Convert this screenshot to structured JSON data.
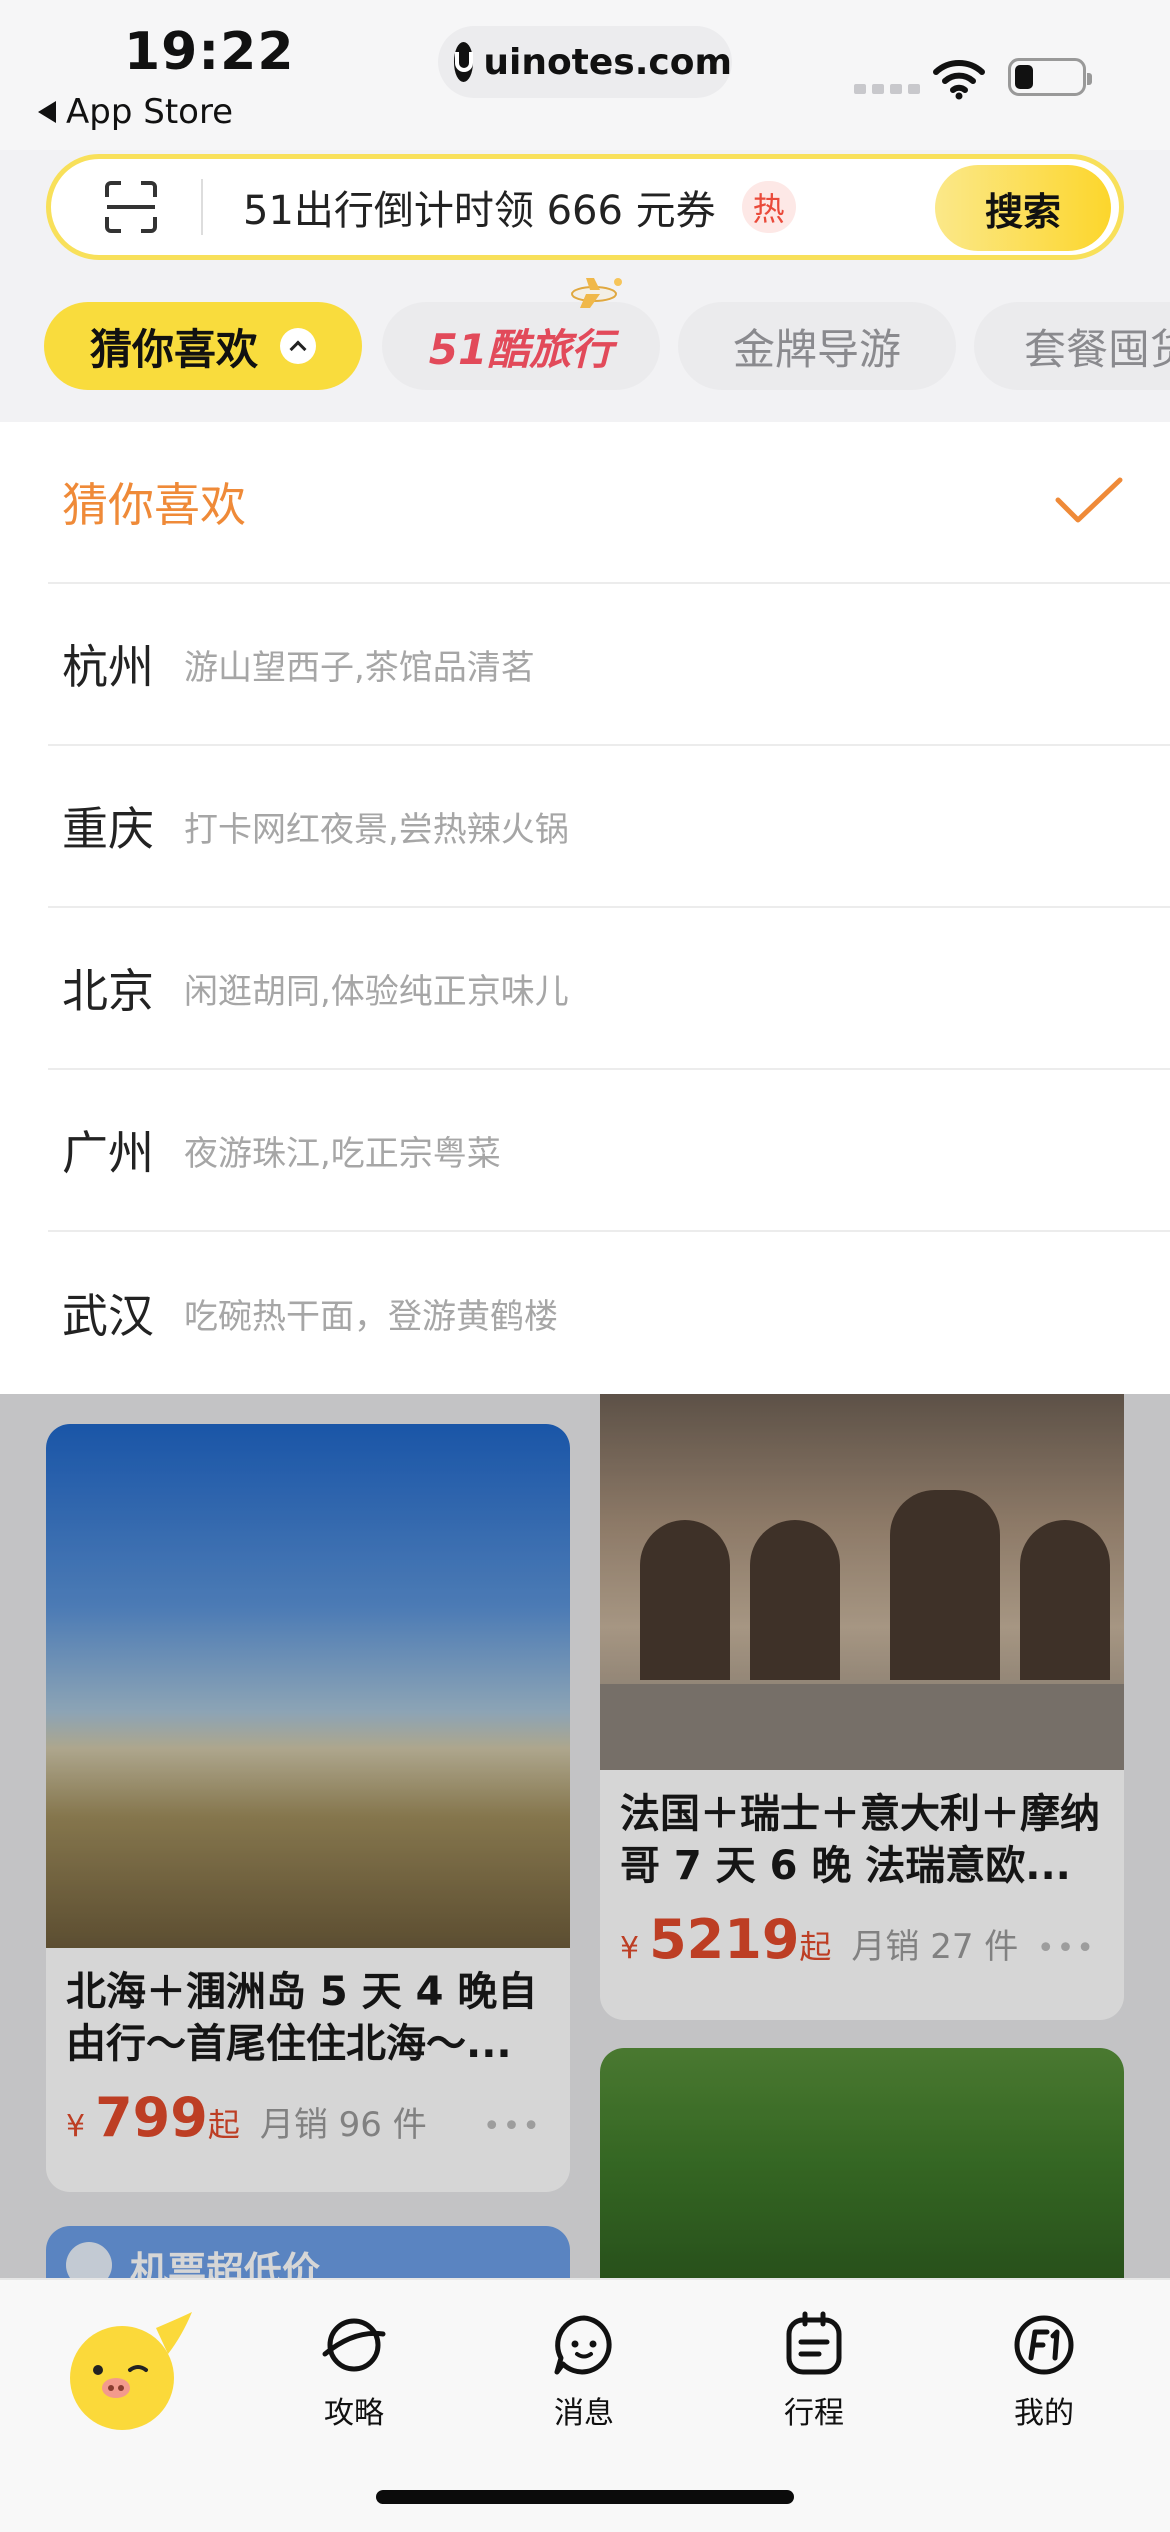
{
  "status_bar": {
    "time": "19:22",
    "back_app": "App Store",
    "url": "uinotes.com"
  },
  "search": {
    "placeholder": "51出行倒计时领 666 元券",
    "hot_badge": "热",
    "button_label": "搜索"
  },
  "tabs": [
    {
      "label": "猜你喜欢",
      "active": true
    },
    {
      "label": "51酷旅行"
    },
    {
      "label": "金牌导游"
    },
    {
      "label": "套餐囤货"
    }
  ],
  "dropdown": {
    "items": [
      {
        "city": "猜你喜欢",
        "desc": "",
        "selected": true
      },
      {
        "city": "杭州",
        "desc": "游山望西子,茶馆品清茗"
      },
      {
        "city": "重庆",
        "desc": "打卡网红夜景,尝热辣火锅"
      },
      {
        "city": "北京",
        "desc": "闲逛胡同,体验纯正京味儿"
      },
      {
        "city": "广州",
        "desc": "夜游珠江,吃正宗粤菜"
      },
      {
        "city": "武汉",
        "desc": "吃碗热干面，登游黄鹤楼"
      }
    ]
  },
  "feed": {
    "cards": [
      {
        "title": "北海＋涠洲岛 5 天 4 晚自由行～首尾住住北海～...",
        "currency": "¥",
        "price": "799",
        "price_suffix": "起",
        "sales": "月销 96 件"
      },
      {
        "title": "法国＋瑞士＋意大利＋摩纳哥 7 天 6 晚 法瑞意欧...",
        "currency": "¥",
        "price": "5219",
        "price_suffix": "起",
        "sales": "月销 27 件"
      }
    ],
    "promo_label": "机票超低价"
  },
  "bottom_nav": {
    "items": [
      {
        "label": "攻略",
        "icon": "planet-icon"
      },
      {
        "label": "消息",
        "icon": "chat-icon"
      },
      {
        "label": "行程",
        "icon": "itinerary-icon"
      },
      {
        "label": "我的",
        "icon": "profile-icon"
      }
    ]
  },
  "colors": {
    "brand_yellow": "#f9dc3d",
    "price_red": "#e24b2c",
    "selected_orange": "#ef8a38"
  }
}
